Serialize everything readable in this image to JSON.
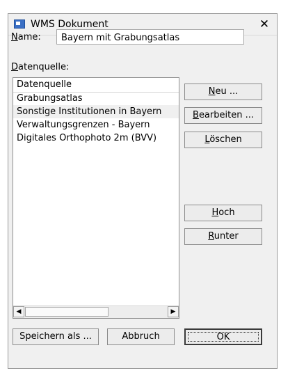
{
  "window": {
    "title": "WMS Dokument",
    "close_glyph": "✕"
  },
  "name_field": {
    "label_accel": "N",
    "label_rest": "ame:",
    "value": "Bayern mit Grabungsatlas"
  },
  "datasource": {
    "label_accel": "D",
    "label_rest": "atenquelle:"
  },
  "list": {
    "column_header": "Datenquelle",
    "rows": [
      "Grabungsatlas",
      "Sonstige Institutionen in Bayern",
      "Verwaltungsgrenzen - Bayern",
      "Digitales Orthophoto 2m (BVV)"
    ],
    "selected_index": 1,
    "scroll_left_glyph": "◀",
    "scroll_right_glyph": "▶"
  },
  "buttons": {
    "neu": {
      "accel": "N",
      "rest": "eu ..."
    },
    "bearbeiten": {
      "accel": "B",
      "rest": "earbeiten ..."
    },
    "loeschen": {
      "accel": "L",
      "rest": "öschen"
    },
    "hoch": {
      "accel": "H",
      "rest": "och"
    },
    "runter": {
      "accel": "R",
      "rest": "unter"
    },
    "speichern": "Speichern als ...",
    "abbruch": "Abbruch",
    "ok": "OK"
  }
}
